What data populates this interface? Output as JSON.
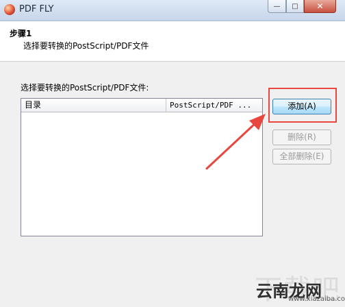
{
  "window": {
    "title": "PDF FLY",
    "minimize_icon": "minimize-icon",
    "maximize_icon": "maximize-icon",
    "close_icon": "close-icon"
  },
  "header": {
    "step_title": "步骤1",
    "step_subtitle": "选择要转换的PostScript/PDF文件"
  },
  "main": {
    "label": "选择要转换的PostScript/PDF文件:",
    "list": {
      "columns": [
        "目录",
        "PostScript/PDF ..."
      ],
      "rows": []
    }
  },
  "buttons": {
    "add": "添加(A)",
    "delete": "删除(R)",
    "delete_all": "全部删除(E)"
  },
  "annotation": {
    "highlight_color": "#e8463e"
  },
  "watermark": {
    "ghost": "下载吧",
    "text": "云南龙网",
    "url": "www.xiazaiba.com"
  }
}
